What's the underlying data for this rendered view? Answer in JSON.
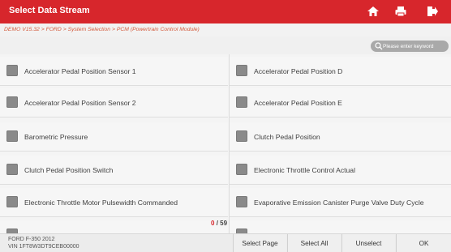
{
  "header": {
    "title": "Select Data Stream",
    "icons": [
      "home-icon",
      "print-icon",
      "exit-icon"
    ]
  },
  "breadcrumb": "DEMO V15.32 > FORD > System Selection > PCM (Powertrain Control Module)",
  "search": {
    "placeholder": "Please enter keyword"
  },
  "items": [
    "Accelerator Pedal Position Sensor 1",
    "Accelerator Pedal Position D",
    "Accelerator Pedal Position Sensor 2",
    "Accelerator Pedal Position E",
    "Barometric Pressure",
    "Clutch Pedal Position",
    "Clutch Pedal Position Switch",
    "Electronic Throttle Control Actual",
    "Electronic Throttle Motor Pulsewidth Commanded",
    "Evaporative Emission Canister Purge Valve Duty Cycle"
  ],
  "counter": {
    "selected": "0",
    "total": "/ 59"
  },
  "vehicle": {
    "model": "FORD F-350 2012",
    "vin": "VIN 1FT8W3DT9CEB00000"
  },
  "buttons": {
    "select_page": "Select Page",
    "select_all": "Select All",
    "unselect": "Unselect",
    "ok": "OK"
  },
  "colors": {
    "accent": "#d7262c",
    "breadcrumb_text": "#d35a3c"
  }
}
